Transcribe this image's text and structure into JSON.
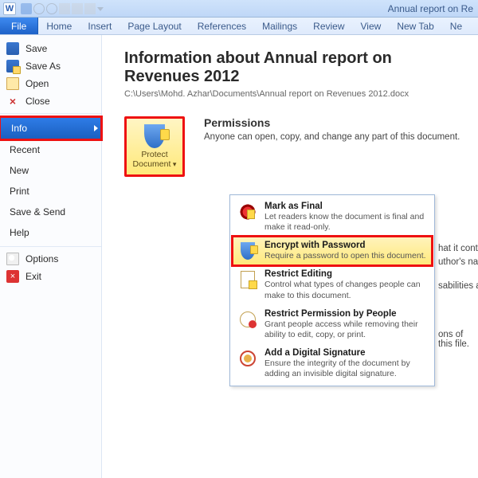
{
  "window": {
    "title": "Annual report on Re"
  },
  "tabs": {
    "file": "File",
    "home": "Home",
    "insert": "Insert",
    "page_layout": "Page Layout",
    "references": "References",
    "mailings": "Mailings",
    "review": "Review",
    "view": "View",
    "new_tab": "New Tab",
    "new_group": "Ne"
  },
  "sidebar": {
    "save": "Save",
    "save_as": "Save As",
    "open": "Open",
    "close": "Close",
    "info": "Info",
    "recent": "Recent",
    "new": "New",
    "print": "Print",
    "save_send": "Save & Send",
    "help": "Help",
    "options": "Options",
    "exit": "Exit"
  },
  "main": {
    "title": "Information about Annual report on Revenues 2012",
    "path": "C:\\Users\\Mohd. Azhar\\Documents\\Annual report on Revenues 2012.docx"
  },
  "protect": {
    "label": "Protect Document",
    "permissions_heading": "Permissions",
    "permissions_text": "Anyone can open, copy, and change any part of this document."
  },
  "dropdown": {
    "mark_final": {
      "title": "Mark as Final",
      "desc": "Let readers know the document is final and make it read-only."
    },
    "encrypt": {
      "title": "Encrypt with Password",
      "desc": "Require a password to open this document."
    },
    "restrict": {
      "title": "Restrict Editing",
      "desc": "Control what types of changes people can make to this document."
    },
    "people": {
      "title": "Restrict Permission by People",
      "desc": "Grant people access while removing their ability to edit, copy, or print."
    },
    "signature": {
      "title": "Add a Digital Signature",
      "desc": "Ensure the integrity of the document by adding an invisible digital signature."
    }
  },
  "behind": {
    "prepare1": "hat it contains:",
    "prepare2": "uthor's name",
    "prepare3": "sabilities are unable to read",
    "versions": "ons of this file."
  }
}
